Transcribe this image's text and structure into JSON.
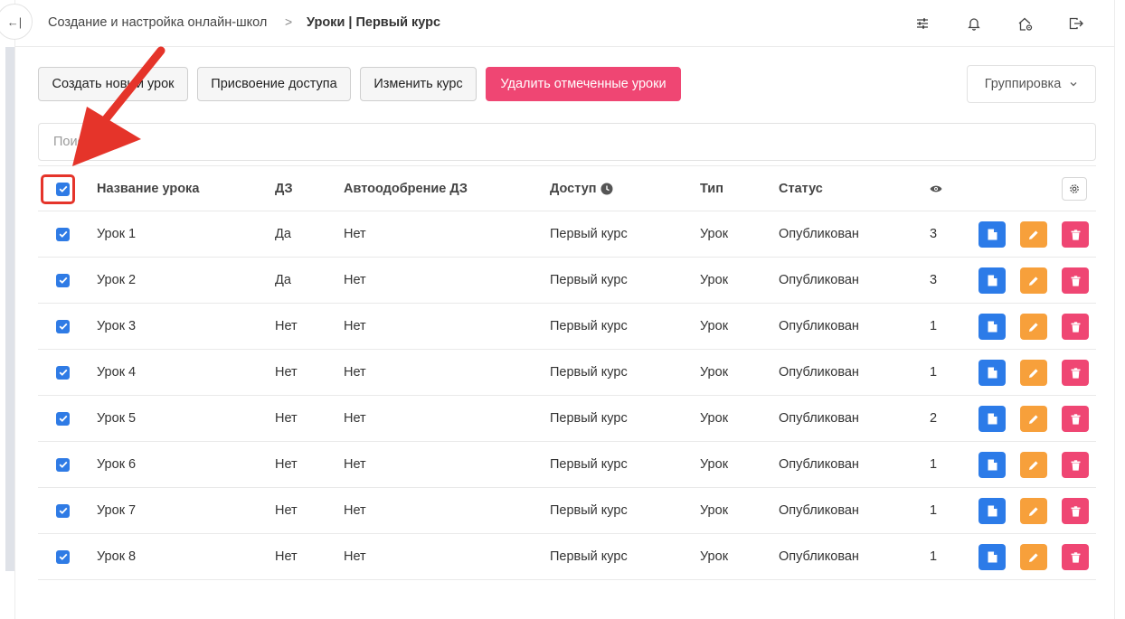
{
  "breadcrumb": {
    "parent": "Создание и настройка онлайн-школ",
    "separator": ">",
    "current": "Уроки | Первый курс"
  },
  "topbar_icons": [
    "sliders-icon",
    "bell-icon",
    "home-settings-icon",
    "logout-icon"
  ],
  "sidebar_toggle_label": "←|",
  "toolbar": {
    "create_lesson": "Создать новый урок",
    "assign_access": "Присвоение доступа",
    "change_course": "Изменить курс",
    "delete_selected": "Удалить отмеченные уроки",
    "grouping": "Группировка"
  },
  "search": {
    "placeholder": "Поиск",
    "value": ""
  },
  "table": {
    "columns": {
      "name": "Название урока",
      "homework": "ДЗ",
      "auto_approve": "Автоодобрение ДЗ",
      "access": "Доступ",
      "type": "Тип",
      "status": "Статус"
    },
    "rows": [
      {
        "name": "Урок 1",
        "homework": "Да",
        "auto_approve": "Нет",
        "access": "Первый курс",
        "type": "Урок",
        "status": "Опубликован",
        "views": "3"
      },
      {
        "name": "Урок 2",
        "homework": "Да",
        "auto_approve": "Нет",
        "access": "Первый курс",
        "type": "Урок",
        "status": "Опубликован",
        "views": "3"
      },
      {
        "name": "Урок 3",
        "homework": "Нет",
        "auto_approve": "Нет",
        "access": "Первый курс",
        "type": "Урок",
        "status": "Опубликован",
        "views": "1"
      },
      {
        "name": "Урок 4",
        "homework": "Нет",
        "auto_approve": "Нет",
        "access": "Первый курс",
        "type": "Урок",
        "status": "Опубликован",
        "views": "1"
      },
      {
        "name": "Урок 5",
        "homework": "Нет",
        "auto_approve": "Нет",
        "access": "Первый курс",
        "type": "Урок",
        "status": "Опубликован",
        "views": "2"
      },
      {
        "name": "Урок 6",
        "homework": "Нет",
        "auto_approve": "Нет",
        "access": "Первый курс",
        "type": "Урок",
        "status": "Опубликован",
        "views": "1"
      },
      {
        "name": "Урок 7",
        "homework": "Нет",
        "auto_approve": "Нет",
        "access": "Первый курс",
        "type": "Урок",
        "status": "Опубликован",
        "views": "1"
      },
      {
        "name": "Урок 8",
        "homework": "Нет",
        "auto_approve": "Нет",
        "access": "Первый курс",
        "type": "Урок",
        "status": "Опубликован",
        "views": "1"
      }
    ]
  },
  "colors": {
    "primary": "#2c7be8",
    "warning": "#f7a03b",
    "danger": "#ef4673",
    "annotation": "#e5342a"
  }
}
